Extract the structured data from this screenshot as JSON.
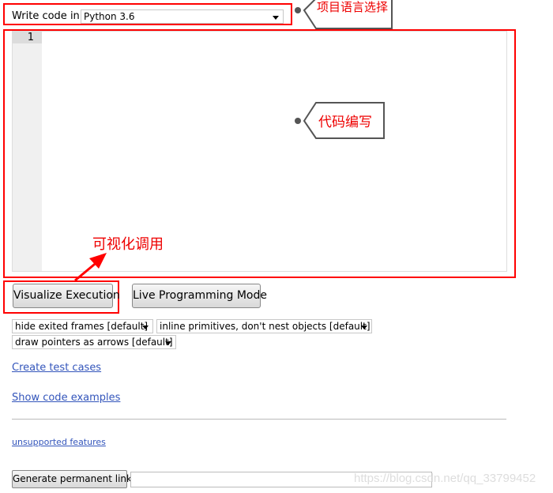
{
  "header": {
    "label": "Write code in",
    "language": "Python 3.6"
  },
  "editor": {
    "line_numbers": [
      "1"
    ],
    "code": ""
  },
  "annotations": {
    "language_select": "项目语言选择",
    "code_writing": "代码编写",
    "visualize_call": "可视化调用",
    "accent_color": "#ff0000"
  },
  "buttons": {
    "visualize": "Visualize Execution",
    "live": "Live Programming Mode",
    "permalink": "Generate permanent link"
  },
  "options": {
    "frames": "hide exited frames [default]",
    "primitives": "inline primitives, don't nest objects [default]",
    "pointers": "draw pointers as arrows [default]"
  },
  "links": {
    "test_cases": "Create test cases",
    "examples": "Show code examples",
    "unsupported": "unsupported features"
  },
  "permalink": {
    "value": ""
  },
  "watermark": "https://blog.csdn.net/qq_33799452"
}
